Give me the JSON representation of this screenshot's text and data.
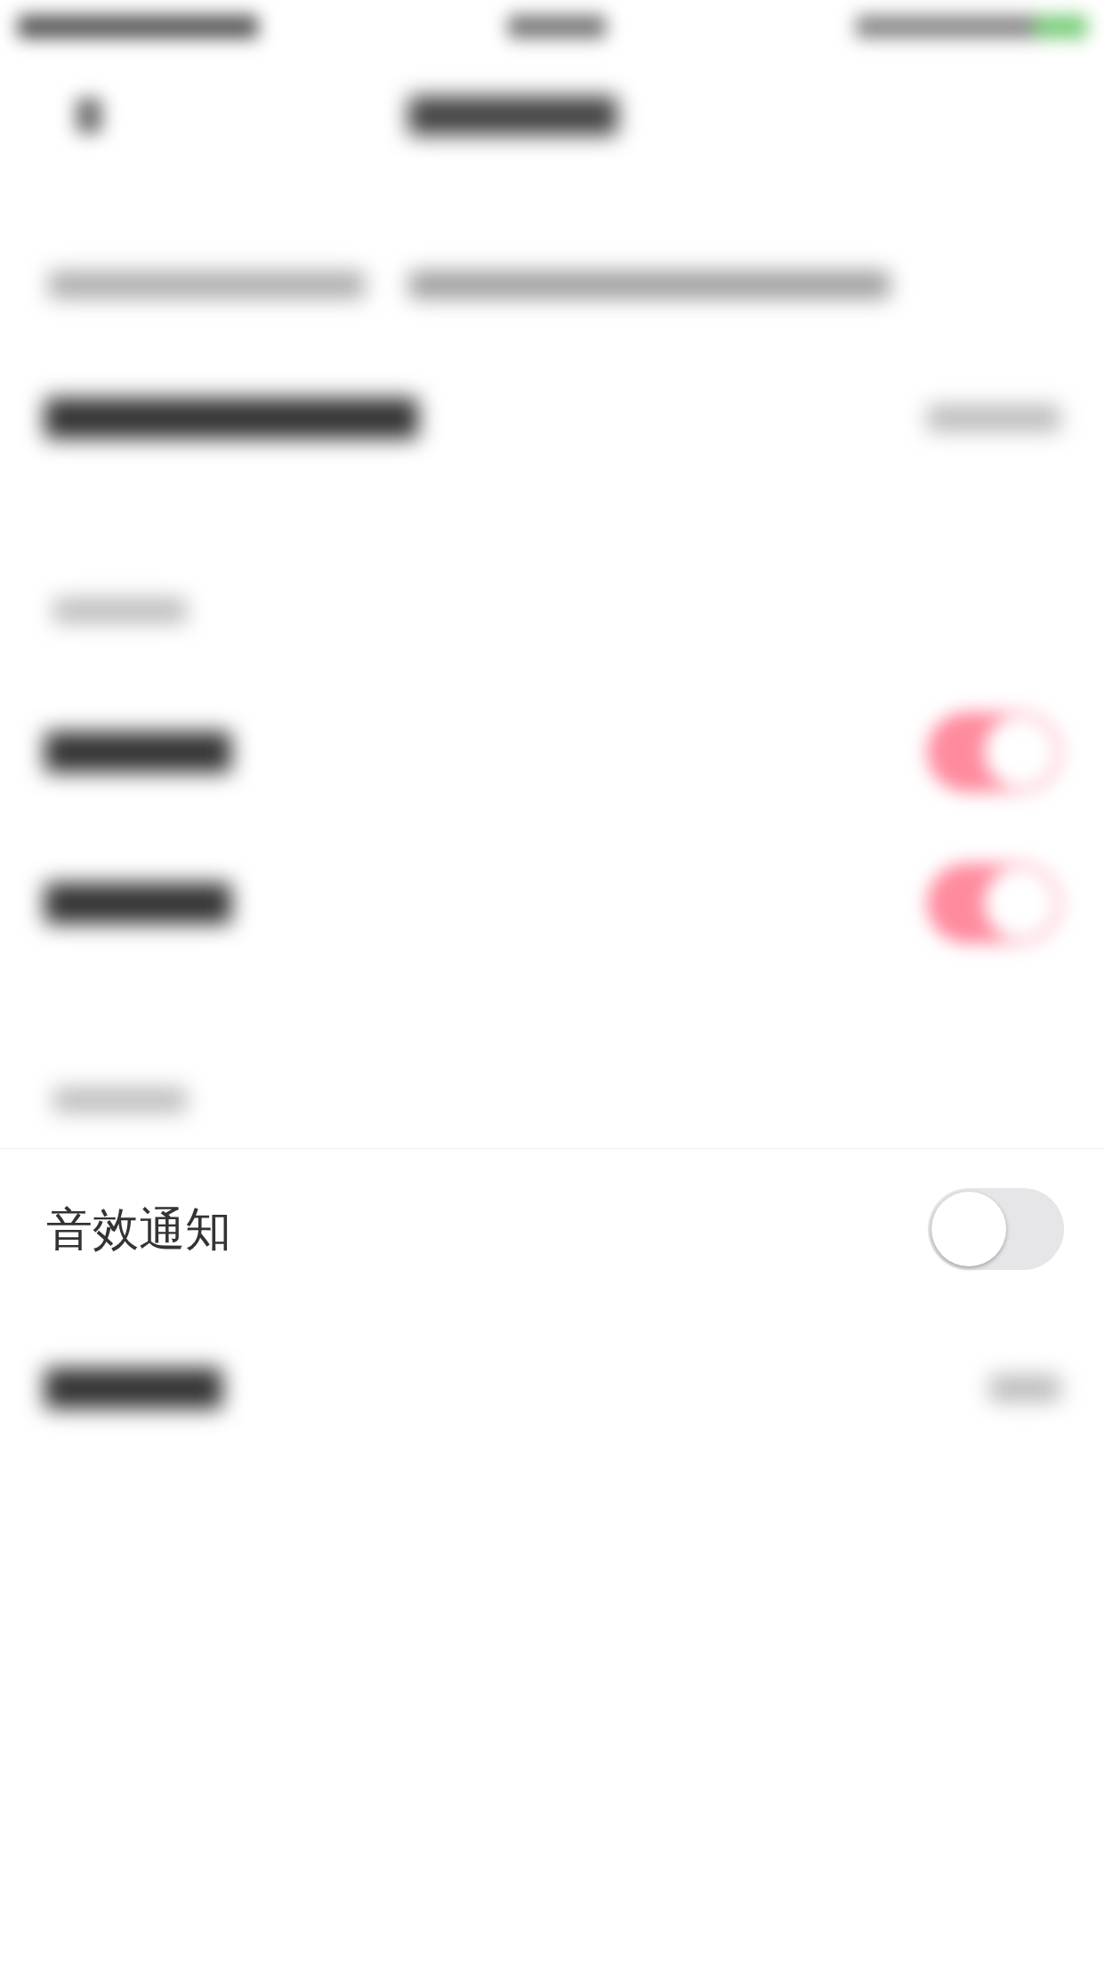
{
  "rows": [
    {
      "kind": "status"
    },
    {
      "kind": "nav"
    },
    {
      "kind": "note"
    },
    {
      "kind": "row-value"
    },
    {
      "kind": "header"
    },
    {
      "kind": "row-toggle",
      "on": true
    },
    {
      "kind": "row-toggle",
      "on": true
    },
    {
      "kind": "header"
    },
    {
      "kind": "toggle",
      "label": "音效通知",
      "on": false
    },
    {
      "kind": "row-value"
    }
  ]
}
